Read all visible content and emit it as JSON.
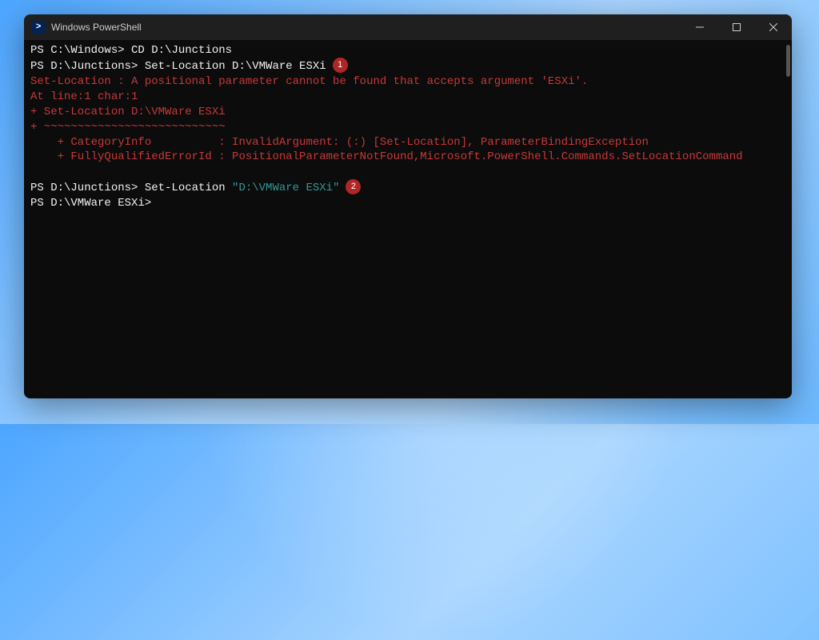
{
  "window": {
    "title": "Windows PowerShell"
  },
  "terminal": {
    "lines": [
      {
        "prompt": "PS C:\\Windows> ",
        "cmd": "CD D:\\Junctions"
      },
      {
        "prompt": "PS D:\\Junctions> ",
        "cmd": "Set-Location D:\\VMWare ESXi",
        "badge": "1"
      }
    ],
    "error": {
      "l1": "Set-Location : A positional parameter cannot be found that accepts argument 'ESXi'.",
      "l2": "At line:1 char:1",
      "l3": "+ Set-Location D:\\VMWare ESXi",
      "l4": "+ ~~~~~~~~~~~~~~~~~~~~~~~~~~~",
      "l5": "    + CategoryInfo          : InvalidArgument: (:) [Set-Location], ParameterBindingException",
      "l6": "    + FullyQualifiedErrorId : PositionalParameterNotFound,Microsoft.PowerShell.Commands.SetLocationCommand"
    },
    "lines2": [
      {
        "prompt": "PS D:\\Junctions> ",
        "cmd": "Set-Location ",
        "quoted": "\"D:\\VMWare ESXi\"",
        "badge": "2"
      },
      {
        "prompt": "PS D:\\VMWare ESXi> "
      }
    ]
  }
}
